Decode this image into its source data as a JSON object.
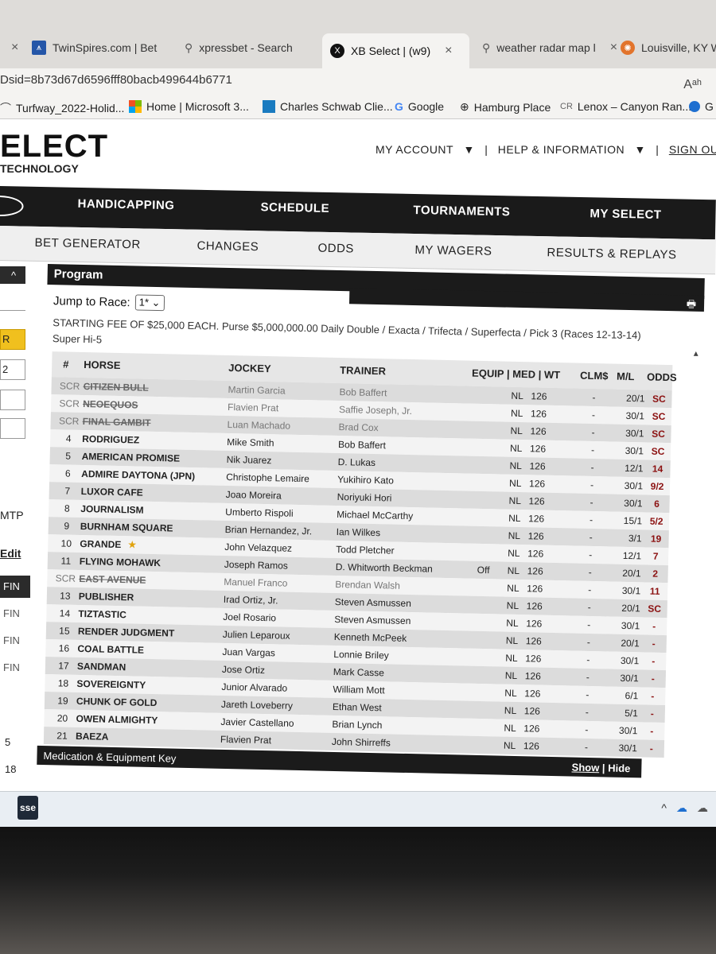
{
  "browser": {
    "tabs": [
      {
        "label": "TwinSpires.com | Bet",
        "active": false
      },
      {
        "label": "xpressbet - Search",
        "active": false
      },
      {
        "label": "XB Select | (w9)",
        "active": true
      },
      {
        "label": "weather radar map l",
        "active": false
      },
      {
        "label": "Louisville, KY Wea",
        "active": false
      }
    ],
    "url": "Dsid=8b73d67d6596fff80bacb499644b6771",
    "reader_icon": "Aᵃʰ",
    "bookmarks": [
      "Turfway_2022-Holid...",
      "Home | Microsoft 3...",
      "Charles Schwab Clie...",
      "Google",
      "Hamburg Place",
      "Lenox – Canyon Ran...",
      "G"
    ]
  },
  "site": {
    "logo": "ELECT",
    "logo_sub": "TECHNOLOGY",
    "account": {
      "my_account": "MY ACCOUNT",
      "help": "HELP & INFORMATION",
      "sign_out": "SIGN OUT"
    },
    "nav_primary": [
      "HANDICAPPING",
      "SCHEDULE",
      "TOURNAMENTS",
      "MY SELECT"
    ],
    "nav_secondary": [
      "BET GENERATOR",
      "CHANGES",
      "ODDS",
      "MY WAGERS",
      "RESULTS & REPLAYS"
    ]
  },
  "sidebar": {
    "box_r": "R",
    "box_2": "2",
    "mtp": "MTP",
    "edit": "Edit",
    "fin": [
      "FIN",
      "FIN",
      "FIN",
      "FIN"
    ],
    "num_5": "5",
    "num_18": "18"
  },
  "program": {
    "title": "Program",
    "jump_label": "Jump to Race:",
    "jump_value": "1*",
    "description_line1": "STARTING FEE OF $25,000 EACH. Purse $5,000,000.00 Daily Double / Exacta / Trifecta / Superfecta / Pick 3 (Races 12-13-14)",
    "description_line2": "Super Hi-5",
    "headers": {
      "num": "#",
      "horse": "HORSE",
      "jockey": "JOCKEY",
      "trainer": "TRAINER",
      "equip": "EQUIP | MED | WT",
      "clm": "CLM$",
      "ml": "M/L",
      "odds": "ODDS"
    },
    "rows": [
      {
        "num": "SCR",
        "horse": "CITIZEN BULL",
        "jockey": "Martin Garcia",
        "trainer": "Bob Baffert",
        "equip": "",
        "med": "NL",
        "wt": "126",
        "clm": "-",
        "ml": "20/1",
        "odds": "SC",
        "scr": true,
        "star": false
      },
      {
        "num": "SCR",
        "horse": "NEOEQUOS",
        "jockey": "Flavien Prat",
        "trainer": "Saffie Joseph, Jr.",
        "equip": "",
        "med": "NL",
        "wt": "126",
        "clm": "-",
        "ml": "30/1",
        "odds": "SC",
        "scr": true,
        "star": false
      },
      {
        "num": "SCR",
        "horse": "FINAL GAMBIT",
        "jockey": "Luan Machado",
        "trainer": "Brad Cox",
        "equip": "",
        "med": "NL",
        "wt": "126",
        "clm": "-",
        "ml": "30/1",
        "odds": "SC",
        "scr": true,
        "star": false
      },
      {
        "num": "4",
        "horse": "RODRIGUEZ",
        "jockey": "Mike Smith",
        "trainer": "Bob Baffert",
        "equip": "",
        "med": "NL",
        "wt": "126",
        "clm": "-",
        "ml": "30/1",
        "odds": "SC",
        "scr": false,
        "star": false
      },
      {
        "num": "5",
        "horse": "AMERICAN PROMISE",
        "jockey": "Nik Juarez",
        "trainer": "D. Lukas",
        "equip": "",
        "med": "NL",
        "wt": "126",
        "clm": "-",
        "ml": "12/1",
        "odds": "14",
        "scr": false,
        "star": false
      },
      {
        "num": "6",
        "horse": "ADMIRE DAYTONA (JPN)",
        "jockey": "Christophe Lemaire",
        "trainer": "Yukihiro Kato",
        "equip": "",
        "med": "NL",
        "wt": "126",
        "clm": "-",
        "ml": "30/1",
        "odds": "9/2",
        "scr": false,
        "star": false
      },
      {
        "num": "7",
        "horse": "LUXOR CAFE",
        "jockey": "Joao Moreira",
        "trainer": "Noriyuki Hori",
        "equip": "",
        "med": "NL",
        "wt": "126",
        "clm": "-",
        "ml": "30/1",
        "odds": "6",
        "scr": false,
        "star": false
      },
      {
        "num": "8",
        "horse": "JOURNALISM",
        "jockey": "Umberto Rispoli",
        "trainer": "Michael McCarthy",
        "equip": "",
        "med": "NL",
        "wt": "126",
        "clm": "-",
        "ml": "15/1",
        "odds": "5/2",
        "scr": false,
        "star": false
      },
      {
        "num": "9",
        "horse": "BURNHAM SQUARE",
        "jockey": "Brian Hernandez, Jr.",
        "trainer": "Ian Wilkes",
        "equip": "",
        "med": "NL",
        "wt": "126",
        "clm": "-",
        "ml": "3/1",
        "odds": "19",
        "scr": false,
        "star": false
      },
      {
        "num": "10",
        "horse": "GRANDE",
        "jockey": "John Velazquez",
        "trainer": "Todd Pletcher",
        "equip": "",
        "med": "NL",
        "wt": "126",
        "clm": "-",
        "ml": "12/1",
        "odds": "7",
        "scr": false,
        "star": true
      },
      {
        "num": "11",
        "horse": "FLYING MOHAWK",
        "jockey": "Joseph Ramos",
        "trainer": "D. Whitworth Beckman",
        "equip": "Off",
        "med": "NL",
        "wt": "126",
        "clm": "-",
        "ml": "20/1",
        "odds": "2",
        "scr": false,
        "star": false
      },
      {
        "num": "SCR",
        "horse": "EAST AVENUE",
        "jockey": "Manuel Franco",
        "trainer": "Brendan Walsh",
        "equip": "",
        "med": "NL",
        "wt": "126",
        "clm": "-",
        "ml": "30/1",
        "odds": "11",
        "scr": true,
        "star": false
      },
      {
        "num": "13",
        "horse": "PUBLISHER",
        "jockey": "Irad Ortiz, Jr.",
        "trainer": "Steven Asmussen",
        "equip": "",
        "med": "NL",
        "wt": "126",
        "clm": "-",
        "ml": "20/1",
        "odds": "SC",
        "scr": false,
        "star": false
      },
      {
        "num": "14",
        "horse": "TIZTASTIC",
        "jockey": "Joel Rosario",
        "trainer": "Steven Asmussen",
        "equip": "",
        "med": "NL",
        "wt": "126",
        "clm": "-",
        "ml": "30/1",
        "odds": "-",
        "scr": false,
        "star": false
      },
      {
        "num": "15",
        "horse": "RENDER JUDGMENT",
        "jockey": "Julien Leparoux",
        "trainer": "Kenneth McPeek",
        "equip": "",
        "med": "NL",
        "wt": "126",
        "clm": "-",
        "ml": "20/1",
        "odds": "-",
        "scr": false,
        "star": false
      },
      {
        "num": "16",
        "horse": "COAL BATTLE",
        "jockey": "Juan Vargas",
        "trainer": "Lonnie Briley",
        "equip": "",
        "med": "NL",
        "wt": "126",
        "clm": "-",
        "ml": "30/1",
        "odds": "-",
        "scr": false,
        "star": false
      },
      {
        "num": "17",
        "horse": "SANDMAN",
        "jockey": "Jose Ortiz",
        "trainer": "Mark Casse",
        "equip": "",
        "med": "NL",
        "wt": "126",
        "clm": "-",
        "ml": "30/1",
        "odds": "-",
        "scr": false,
        "star": false
      },
      {
        "num": "18",
        "horse": "SOVEREIGNTY",
        "jockey": "Junior Alvarado",
        "trainer": "William Mott",
        "equip": "",
        "med": "NL",
        "wt": "126",
        "clm": "-",
        "ml": "6/1",
        "odds": "-",
        "scr": false,
        "star": false
      },
      {
        "num": "19",
        "horse": "CHUNK OF GOLD",
        "jockey": "Jareth Loveberry",
        "trainer": "Ethan West",
        "equip": "",
        "med": "NL",
        "wt": "126",
        "clm": "-",
        "ml": "5/1",
        "odds": "-",
        "scr": false,
        "star": false
      },
      {
        "num": "20",
        "horse": "OWEN ALMIGHTY",
        "jockey": "Javier Castellano",
        "trainer": "Brian Lynch",
        "equip": "",
        "med": "NL",
        "wt": "126",
        "clm": "-",
        "ml": "30/1",
        "odds": "-",
        "scr": false,
        "star": false
      },
      {
        "num": "21",
        "horse": "BAEZA",
        "jockey": "Flavien Prat",
        "trainer": "John Shirreffs",
        "equip": "",
        "med": "NL",
        "wt": "126",
        "clm": "-",
        "ml": "30/1",
        "odds": "-",
        "scr": false,
        "star": false
      }
    ],
    "last_ml": "12/1",
    "med_key": {
      "label": "Medication & Equipment Key",
      "show": "Show",
      "hide": "Hide"
    }
  },
  "taskbar": {
    "app": "sse",
    "tray": [
      "^",
      "☁",
      "☁"
    ]
  },
  "colors": {
    "odds_red": "#8b1010",
    "nav_dark": "#1a1a1a",
    "warning_yellow": "#f0c01e"
  }
}
